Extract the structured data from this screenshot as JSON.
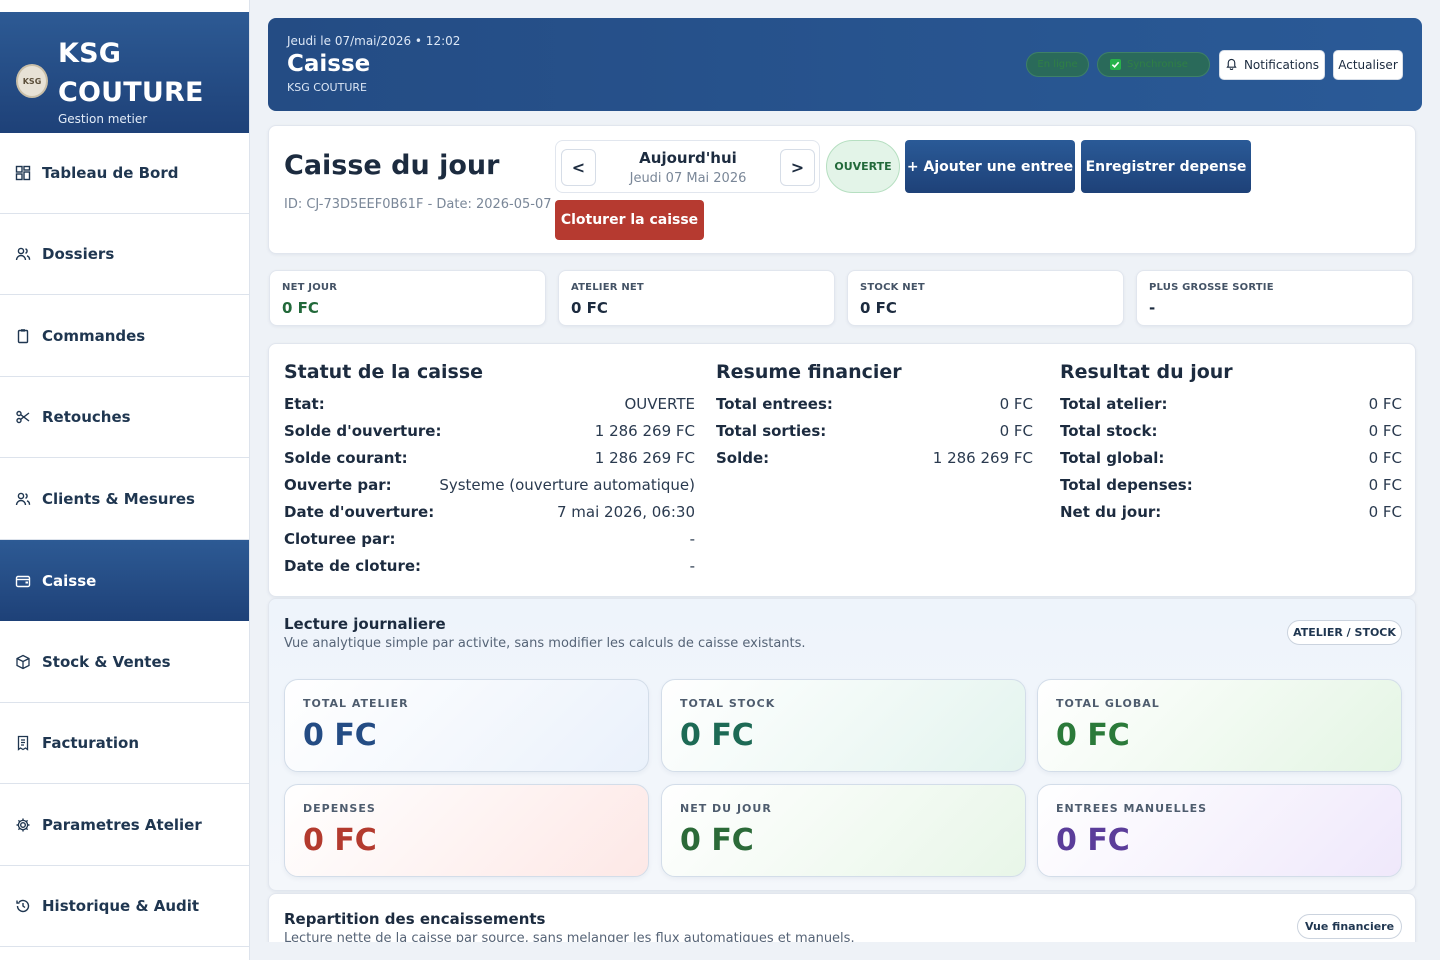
{
  "brand": {
    "title": "KSG COUTURE",
    "subtitle": "Gestion metier",
    "logo_text": "KSG"
  },
  "nav": [
    {
      "label": "Tableau de Bord",
      "icon": "dashboard-icon"
    },
    {
      "label": "Dossiers",
      "icon": "users-icon"
    },
    {
      "label": "Commandes",
      "icon": "clipboard-icon"
    },
    {
      "label": "Retouches",
      "icon": "scissors-icon"
    },
    {
      "label": "Clients & Mesures",
      "icon": "users-icon"
    },
    {
      "label": "Caisse",
      "icon": "wallet-icon",
      "active": true
    },
    {
      "label": "Stock & Ventes",
      "icon": "box-icon"
    },
    {
      "label": "Facturation",
      "icon": "invoice-icon"
    },
    {
      "label": "Parametres Atelier",
      "icon": "gear-icon"
    },
    {
      "label": "Historique & Audit",
      "icon": "history-icon"
    }
  ],
  "header": {
    "date_line": "Jeudi le 07/mai/2026 • 12:02",
    "title": "Caisse",
    "subtitle": "KSG COUTURE",
    "online_label": "En ligne",
    "sync_label": "Synchronise",
    "notifications_label": "Notifications",
    "refresh_label": "Actualiser"
  },
  "caisse": {
    "title": "Caisse du jour",
    "id_line": "ID: CJ-73D5EEF0B61F - Date: 2026-05-07",
    "date_nav": {
      "prev": "<",
      "next": ">",
      "main": "Aujourd'hui",
      "sub": "Jeudi 07 Mai 2026"
    },
    "status": "OUVERTE",
    "add_entry_label": "+ Ajouter une entree",
    "expense_label": "Enregistrer depense",
    "close_label": "Cloturer la caisse"
  },
  "kpis": [
    {
      "label": "NET JOUR",
      "value": "0 FC",
      "accent": "green"
    },
    {
      "label": "ATELIER NET",
      "value": "0 FC",
      "accent": ""
    },
    {
      "label": "STOCK NET",
      "value": "0 FC",
      "accent": ""
    },
    {
      "label": "PLUS GROSSE SORTIE",
      "value": "-",
      "accent": ""
    }
  ],
  "statut": {
    "title": "Statut de la caisse",
    "rows": [
      {
        "k": "Etat:",
        "v": "OUVERTE"
      },
      {
        "k": "Solde d'ouverture:",
        "v": "1 286 269 FC"
      },
      {
        "k": "Solde courant:",
        "v": "1 286 269 FC"
      },
      {
        "k": "Ouverte par:",
        "v": "Systeme (ouverture automatique)"
      },
      {
        "k": "Date d'ouverture:",
        "v": "7 mai 2026, 06:30"
      },
      {
        "k": "Cloturee par:",
        "v": "-"
      },
      {
        "k": "Date de cloture:",
        "v": "-"
      }
    ]
  },
  "resume": {
    "title": "Resume financier",
    "rows": [
      {
        "k": "Total entrees:",
        "v": "0 FC"
      },
      {
        "k": "Total sorties:",
        "v": "0 FC"
      },
      {
        "k": "Solde:",
        "v": "1 286 269 FC"
      }
    ]
  },
  "resultat": {
    "title": "Resultat du jour",
    "rows": [
      {
        "k": "Total atelier:",
        "v": "0 FC"
      },
      {
        "k": "Total stock:",
        "v": "0 FC"
      },
      {
        "k": "Total global:",
        "v": "0 FC"
      },
      {
        "k": "Total depenses:",
        "v": "0 FC"
      },
      {
        "k": "Net du jour:",
        "v": "0 FC"
      }
    ]
  },
  "lecture": {
    "title": "Lecture journaliere",
    "subtitle": "Vue analytique simple par activite, sans modifier les calculs de caisse existants.",
    "tag": "ATELIER / STOCK",
    "tiles": [
      {
        "label": "TOTAL ATELIER",
        "value": "0 FC",
        "theme": "t-blue"
      },
      {
        "label": "TOTAL STOCK",
        "value": "0 FC",
        "theme": "t-teal"
      },
      {
        "label": "TOTAL GLOBAL",
        "value": "0 FC",
        "theme": "t-green"
      },
      {
        "label": "DEPENSES",
        "value": "0 FC",
        "theme": "t-red"
      },
      {
        "label": "NET DU JOUR",
        "value": "0 FC",
        "theme": "t-green2"
      },
      {
        "label": "ENTREES MANUELLES",
        "value": "0 FC",
        "theme": "t-purple"
      }
    ]
  },
  "repartition": {
    "title": "Repartition des encaissements",
    "subtitle": "Lecture nette de la caisse par source, sans melanger les flux automatiques et manuels.",
    "tag": "Vue financiere"
  }
}
